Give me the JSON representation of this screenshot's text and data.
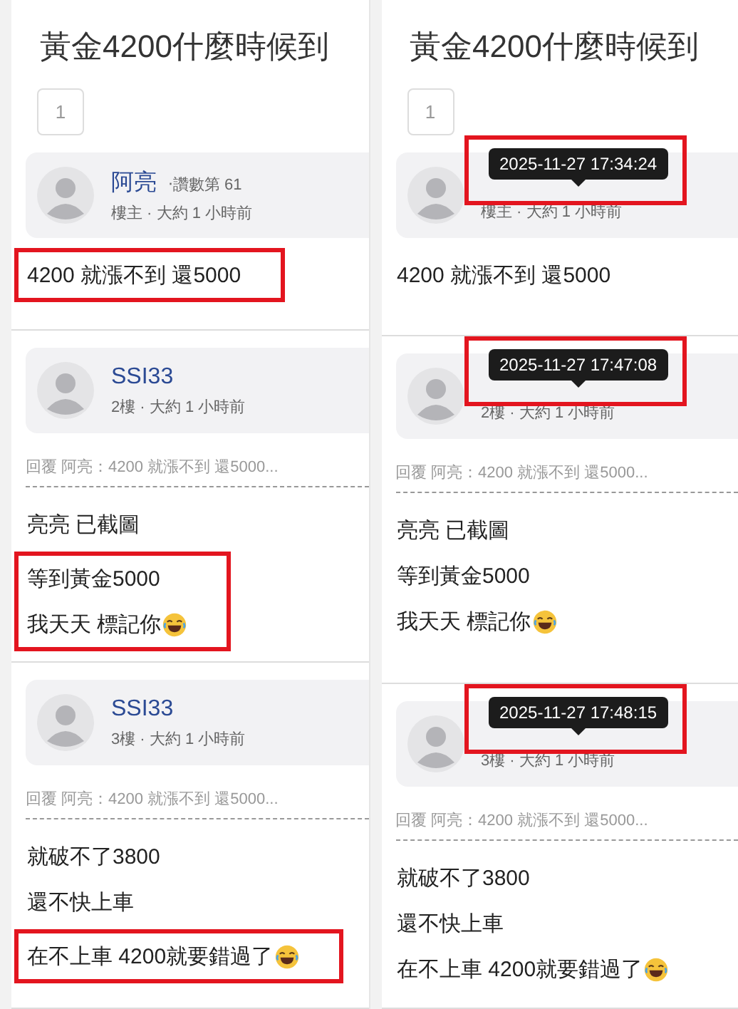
{
  "columns": [
    {
      "panels": [
        {
          "title": "黃金4200什麼時候到",
          "page_button": "1",
          "post": {
            "name": "阿亮",
            "rank": "‧讚數第 61",
            "meta": "樓主 · 大約 1 小時前",
            "lines": [
              {
                "text": "4200 就漲不到 還5000",
                "highlighted": true,
                "emoji": false
              }
            ]
          }
        },
        {
          "post": {
            "name": "SSI33",
            "meta": "2樓 · 大約 1 小時前",
            "quote": "回覆 阿亮：4200 就漲不到 還5000...",
            "lines": [
              {
                "text": "亮亮 已截圖",
                "highlighted": false,
                "emoji": false
              },
              {
                "text": "等到黃金5000",
                "highlighted": true,
                "emoji": false
              },
              {
                "text": "我天天 標記你",
                "highlighted": true,
                "emoji": true
              }
            ]
          }
        },
        {
          "post": {
            "name": "SSI33",
            "meta": "3樓 · 大約 1 小時前",
            "quote": "回覆 阿亮：4200 就漲不到 還5000...",
            "lines": [
              {
                "text": "就破不了3800",
                "highlighted": false,
                "emoji": false
              },
              {
                "text": "還不快上車",
                "highlighted": false,
                "emoji": false
              },
              {
                "text": "在不上車 4200就要錯過了",
                "highlighted": true,
                "emoji": true
              }
            ]
          }
        }
      ]
    },
    {
      "panels": [
        {
          "title": "黃金4200什麼時候到",
          "page_button": "1",
          "post": {
            "meta": "樓主 · 大約 1 小時前",
            "tooltip": {
              "text": "2025-11-27 17:34:24",
              "highlighted": true
            },
            "lines": [
              {
                "text": "4200 就漲不到 還5000",
                "highlighted": false,
                "emoji": false
              }
            ]
          }
        },
        {
          "post": {
            "meta": "2樓 · 大約 1 小時前",
            "tooltip": {
              "text": "2025-11-27 17:47:08",
              "highlighted": true
            },
            "quote": "回覆 阿亮：4200 就漲不到 還5000...",
            "lines": [
              {
                "text": "亮亮 已截圖",
                "highlighted": false,
                "emoji": false
              },
              {
                "text": "等到黃金5000",
                "highlighted": false,
                "emoji": false
              },
              {
                "text": "我天天 標記你",
                "highlighted": false,
                "emoji": true
              }
            ]
          }
        },
        {
          "post": {
            "meta": "3樓 · 大約 1 小時前",
            "tooltip": {
              "text": "2025-11-27 17:48:15",
              "highlighted": true
            },
            "quote": "回覆 阿亮：4200 就漲不到 還5000...",
            "lines": [
              {
                "text": "就破不了3800",
                "highlighted": false,
                "emoji": false
              },
              {
                "text": "還不快上車",
                "highlighted": false,
                "emoji": false
              },
              {
                "text": "在不上車 4200就要錯過了",
                "highlighted": false,
                "emoji": true
              }
            ]
          }
        }
      ]
    }
  ]
}
